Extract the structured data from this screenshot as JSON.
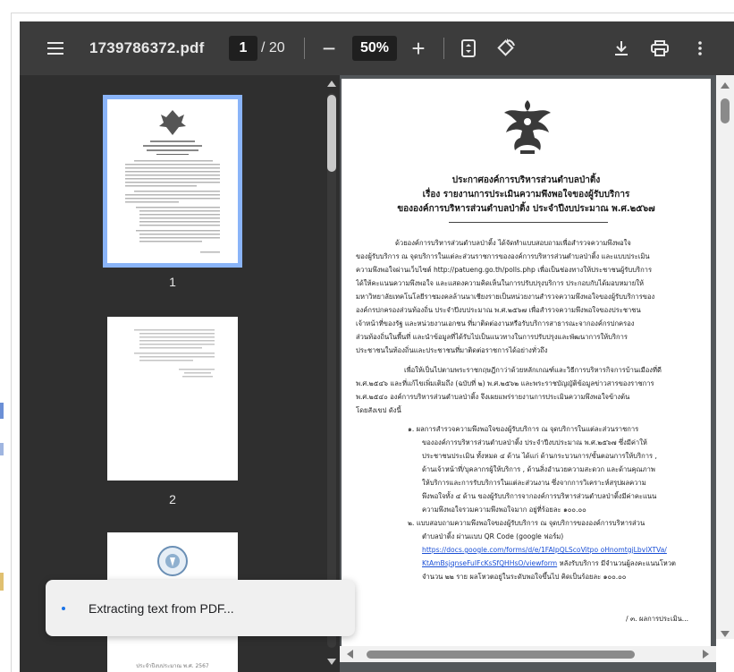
{
  "toolbar": {
    "filename": "1739786372.pdf",
    "current_page": "1",
    "page_total": "/ 20",
    "zoom_minus": "−",
    "zoom_level": "50%",
    "zoom_plus": "+",
    "icons": {
      "menu": "menu-icon",
      "fit": "fit-to-page-icon",
      "rotate": "rotate-icon",
      "download": "download-icon",
      "print": "print-icon",
      "more": "more-vert-icon"
    }
  },
  "sidebar": {
    "thumbnails": [
      {
        "number": "1",
        "selected": true
      },
      {
        "number": "2",
        "selected": false
      },
      {
        "number": "",
        "selected": false
      }
    ],
    "thumb3_footer": "ประจำปีงบประมาณ พ.ศ. 2567"
  },
  "document": {
    "heading_line1": "ประกาศองค์การบริหารส่วนตำบลป่าติ้ง",
    "heading_line2": "เรื่อง   รายงานการประเมินความพึงพอใจของผู้รับบริการ",
    "heading_line3": "ขององค์การบริหารส่วนตำบลป่าติ้ง ประจำปีงบประมาณ พ.ศ.๒๕๖๗",
    "para1": [
      "ด้วยองค์การบริหารส่วนตำบลป่าติ้ง ได้จัดทำแบบสอบถามเพื่อสำรวจความพึงพอใจ",
      "ของผู้รับบริการ ณ จุดบริการในแต่ละส่วนราชการขององค์การบริหารส่วนตำบลป่าติ้ง และแบบประเมิน",
      "ความพึงพอใจผ่านเว็บไซต์ http://patueng.go.th/polls.php เพื่อเป็นช่องทางให้ประชาชนผู้รับบริการ",
      "ได้ให้คะแนนความพึงพอใจ และแสดงความคิดเห็นในการปรับปรุงบริการ ประกอบกับได้มอบหมายให้",
      "มหาวิทยาลัยเทคโนโลยีราชมงคลล้านนาเชียงรายเป็นหน่วยงานสำรวจความพึงพอใจของผู้รับบริการของ",
      "องค์กรปกครองส่วนท้องถิ่น ประจำปีงบประมาณ พ.ศ.๒๕๖๗ เพื่อสำรวจความพึงพอใจของประชาชน",
      "เจ้าหน้าที่ของรัฐ และหน่วยงานเอกชน ที่มาติดต่องานหรือรับบริการสาธารณะจากองค์กรปกครอง",
      "ส่วนท้องถิ่นในพื้นที่ และนำข้อมูลที่ได้รับไปเป็นแนวทางในการปรับปรุงและพัฒนาการให้บริการ",
      "ประชาชนในท้องถิ่นและประชาชนที่มาติดต่อราชการได้อย่างทั่วถึง"
    ],
    "para2": [
      "เพื่อให้เป็นไปตามพระราชกฤษฎีกาว่าด้วยหลักเกณฑ์และวิธีการบริหารกิจการบ้านเมืองที่ดี",
      "พ.ศ.๒๕๔๖ และที่แก้ไขเพิ่มเติมถึง (ฉบับที่ ๒) พ.ศ.๒๕๖๒ และพระราชบัญญัติข้อมูลข่าวสารของราชการ",
      "พ.ศ.๒๕๔๐ องค์การบริหารส่วนตำบลป่าติ้ง จึงเผยแพร่รายงานการประเมินความพึงพอใจข้างต้น",
      "โดยสังเขป ดังนี้"
    ],
    "item1": [
      "๑. ผลการสำรวจความพึงพอใจของผู้รับบริการ ณ จุดบริการในแต่ละส่วนราชการ",
      "ขององค์การบริหารส่วนตำบลป่าติ้ง ประจำปีงบประมาณ พ.ศ.๒๕๖๗ ซึ่งมีค่าให้",
      "ประชาชนประเมิน ทั้งหมด ๔ ด้าน ได้แก่ ด้านกระบวนการ/ขั้นตอนการให้บริการ ,",
      "ด้านเจ้าหน้าที่/บุคลากรผู้ให้บริการ , ด้านสิ่งอำนวยความสะดวก และด้านคุณภาพ",
      "ให้บริการและการรับบริการในแต่ละส่วนงาน ซึ่งจากการวิเคราะห์สรุปผลความ",
      "พึงพอใจทั้ง ๔ ด้าน ของผู้รับบริการจากองค์การบริหารส่วนตำบลป่าติ้งมีค่าคะแนน",
      "ความพึงพอใจรวมความพึงพอใจมาก อยู่ที่ร้อยละ ๑๐๐.๐๐"
    ],
    "item2_line1": "๒. แบบสอบถามความพึงพอใจของผู้รับบริการ ณ จุดบริการขององค์การบริหารส่วน",
    "item2_line2": "ตำบลป่าติ้ง ผ่านแบบ QR Code (google ฟอร์ม)",
    "item2_link1": "https://docs.google.com/forms/d/e/1FAIpQLScoVitpo oHnomtgjLbvlXTVa/",
    "item2_link2": "KtAmBsjqnseFuIFcKsSfQHHsO/viewform",
    "item2_after_link": " หลังรับบริการ มีจำนวนผู้ลงคะแนนโหวต",
    "item2_line5": "จำนวน ๒๒ ราย ผลโหวตอยู่ในระดับพอใจขึ้นไป คิดเป็นร้อยละ ๑๐๐.๐๐",
    "continued": "/ ๓. ผลการประเมิน..."
  },
  "toast": {
    "message": "Extracting text from PDF..."
  },
  "colors": {
    "toolbar_bg": "#3c3c3c",
    "sidebar_bg": "#2f2f2f",
    "viewer_bg": "#525659",
    "selected_outline": "#8ab4f8",
    "link": "#1a4fd6"
  }
}
